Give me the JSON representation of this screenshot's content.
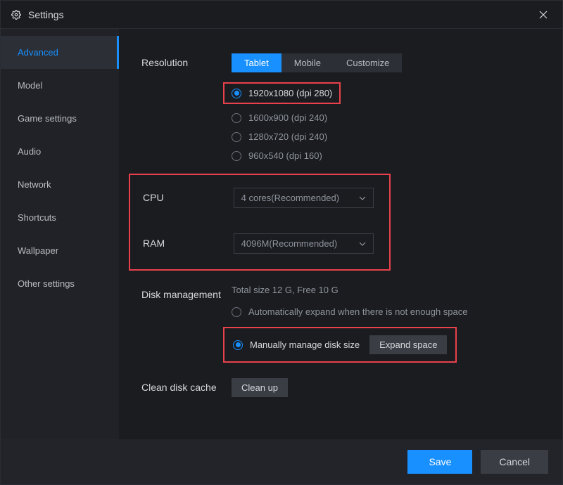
{
  "window": {
    "title": "Settings"
  },
  "sidebar": {
    "items": [
      {
        "label": "Advanced",
        "active": true
      },
      {
        "label": "Model",
        "active": false
      },
      {
        "label": "Game settings",
        "active": false
      },
      {
        "label": "Audio",
        "active": false
      },
      {
        "label": "Network",
        "active": false
      },
      {
        "label": "Shortcuts",
        "active": false
      },
      {
        "label": "Wallpaper",
        "active": false
      },
      {
        "label": "Other settings",
        "active": false
      }
    ]
  },
  "resolution": {
    "label": "Resolution",
    "tabs": {
      "tablet": "Tablet",
      "mobile": "Mobile",
      "customize": "Customize"
    },
    "options": [
      {
        "label": "1920x1080  (dpi 280)",
        "checked": true
      },
      {
        "label": "1600x900  (dpi 240)",
        "checked": false
      },
      {
        "label": "1280x720  (dpi 240)",
        "checked": false
      },
      {
        "label": "960x540  (dpi 160)",
        "checked": false
      }
    ]
  },
  "cpu": {
    "label": "CPU",
    "value": "4 cores(Recommended)"
  },
  "ram": {
    "label": "RAM",
    "value": "4096M(Recommended)"
  },
  "disk": {
    "label": "Disk management",
    "info": "Total size 12 G,   Free 10 G",
    "auto_label": "Automatically expand when there is not enough space",
    "manual_label": "Manually manage disk size",
    "expand_button": "Expand space"
  },
  "clean": {
    "label": "Clean disk cache",
    "button": "Clean up"
  },
  "footer": {
    "save": "Save",
    "cancel": "Cancel"
  }
}
